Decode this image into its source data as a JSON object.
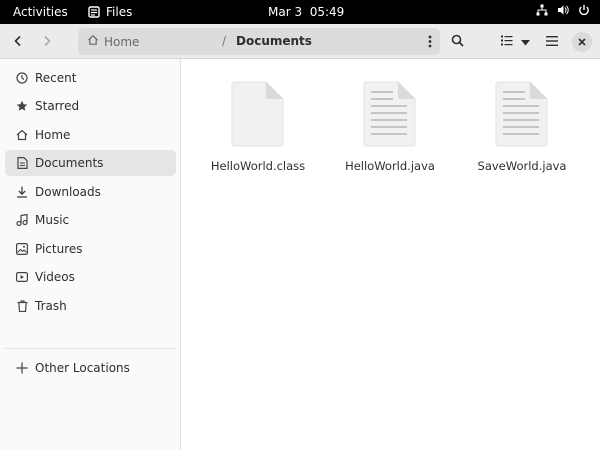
{
  "topbar": {
    "activities": "Activities",
    "app_name": "Files",
    "clock": "Mar 3  05:49",
    "tray_icons": [
      "network-icon",
      "volume-icon",
      "power-icon"
    ]
  },
  "headerbar": {
    "path_home": "Home",
    "path_separator": "/",
    "path_current": "Documents"
  },
  "sidebar": {
    "items": [
      {
        "label": "Recent",
        "icon": "clock-icon"
      },
      {
        "label": "Starred",
        "icon": "star-icon"
      },
      {
        "label": "Home",
        "icon": "home-icon"
      },
      {
        "label": "Documents",
        "icon": "document-icon",
        "active": true
      },
      {
        "label": "Downloads",
        "icon": "download-icon"
      },
      {
        "label": "Music",
        "icon": "music-icon"
      },
      {
        "label": "Pictures",
        "icon": "picture-icon"
      },
      {
        "label": "Videos",
        "icon": "video-icon"
      },
      {
        "label": "Trash",
        "icon": "trash-icon"
      }
    ],
    "other_locations": "Other Locations"
  },
  "files": [
    {
      "name": "HelloWorld.class",
      "type": "binary"
    },
    {
      "name": "HelloWorld.java",
      "type": "text"
    },
    {
      "name": "SaveWorld.java",
      "type": "text"
    }
  ],
  "colors": {
    "topbar_bg": "#000000",
    "headerbar_bg": "#ebebeb",
    "sidebar_bg": "#fafafa",
    "active_item_bg": "#e5e5e5"
  }
}
